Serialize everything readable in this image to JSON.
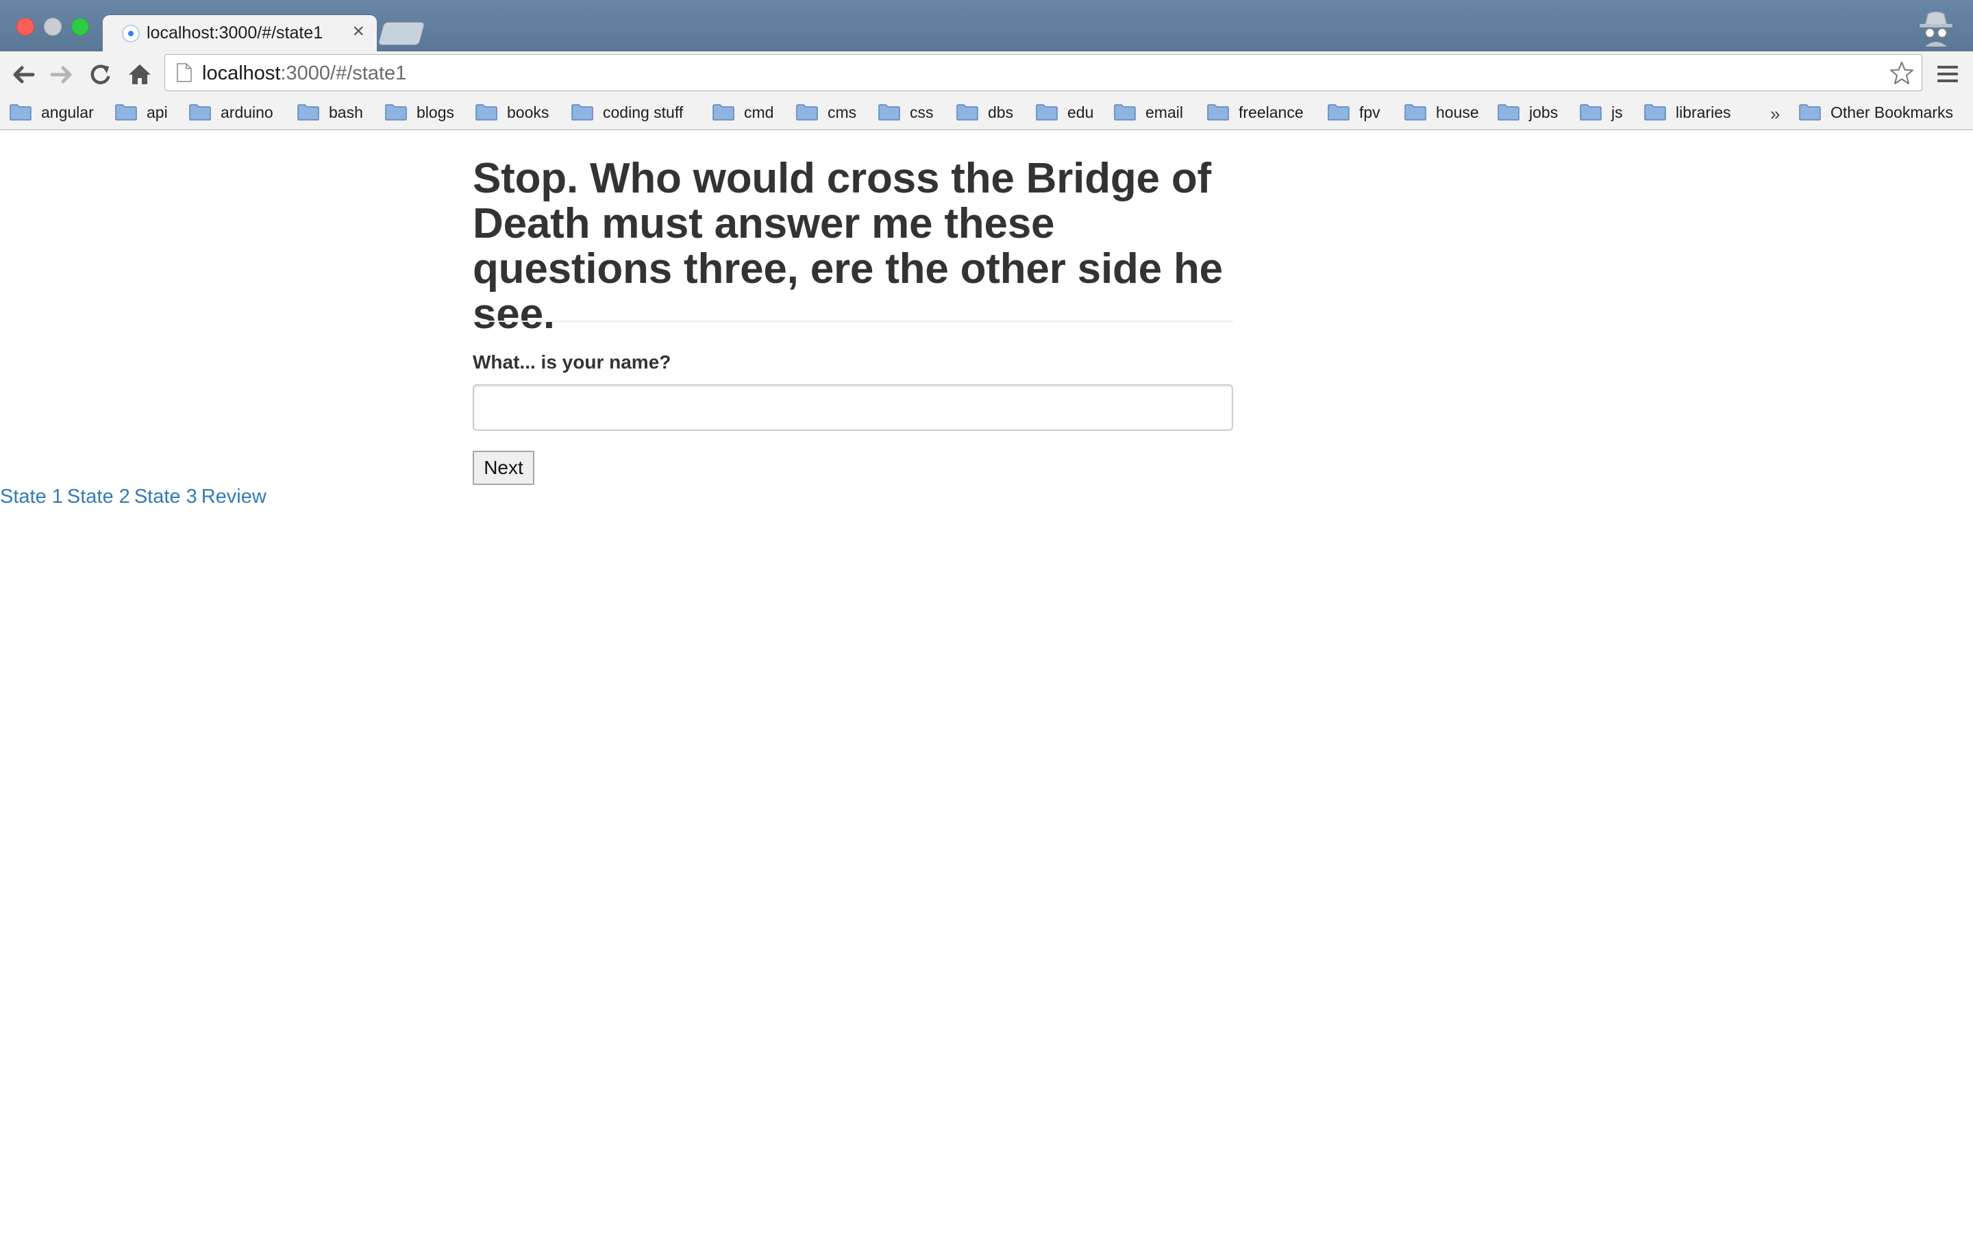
{
  "browser": {
    "tab": {
      "title": "localhost:3000/#/state1",
      "close_glyph": "×"
    },
    "address": {
      "host": "localhost",
      "path": ":3000/#/state1"
    },
    "bookmarks": [
      "angular",
      "api",
      "arduino",
      "bash",
      "blogs",
      "books",
      "coding stuff",
      "cmd",
      "cms",
      "css",
      "dbs",
      "edu",
      "email",
      "freelance",
      "fpv",
      "house",
      "jobs",
      "js",
      "libraries"
    ],
    "bookmarks_overflow": "»",
    "other_bookmarks": "Other Bookmarks",
    "colors": {
      "titlebar": "#5f7b9b",
      "folder": "#7aa3d6"
    }
  },
  "page": {
    "heading": "Stop. Who would cross the Bridge of Death must answer me these questions three, ere the other side he see.",
    "form": {
      "label": "What... is your name?",
      "input_value": "",
      "next_label": "Next"
    },
    "nav": [
      "State 1",
      "State 2",
      "State 3",
      "Review"
    ],
    "colors": {
      "link": "#337ab7",
      "text": "#333333"
    }
  },
  "icons": [
    "back-icon",
    "forward-icon",
    "reload-icon",
    "home-icon",
    "page-icon",
    "star-icon",
    "menu-icon",
    "folder-icon",
    "incognito-icon"
  ]
}
